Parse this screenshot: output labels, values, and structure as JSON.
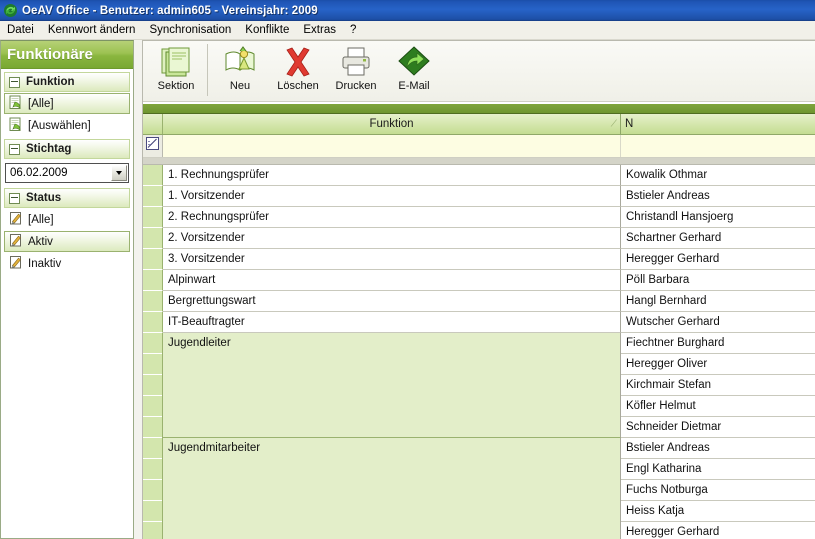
{
  "window": {
    "title": "OeAV Office - Benutzer: admin605 - Vereinsjahr: 2009",
    "app_icon": "refresh-circle-icon"
  },
  "menubar": {
    "items": [
      {
        "label": "Datei"
      },
      {
        "label": "Kennwort ändern"
      },
      {
        "label": "Synchronisation"
      },
      {
        "label": "Konflikte"
      },
      {
        "label": "Extras"
      },
      {
        "label": "?"
      }
    ]
  },
  "sidebar": {
    "title": "Funktionäre",
    "groups": [
      {
        "label": "Funktion",
        "collapse_icon": "minus-box-icon",
        "items": [
          {
            "label": "[Alle]",
            "icon": "document-green-icon",
            "selected": true
          },
          {
            "label": "[Auswählen]",
            "icon": "document-green-icon",
            "selected": false
          }
        ]
      },
      {
        "label": "Stichtag",
        "collapse_icon": "minus-box-icon",
        "date_value": "06.02.2009",
        "date_dropdown_icon": "chevron-down-icon"
      },
      {
        "label": "Status",
        "collapse_icon": "minus-box-icon",
        "items": [
          {
            "label": "[Alle]",
            "icon": "pencil-note-icon",
            "selected": false
          },
          {
            "label": "Aktiv",
            "icon": "pencil-note-icon",
            "selected": true
          },
          {
            "label": "Inaktiv",
            "icon": "pencil-note-icon",
            "selected": false
          }
        ]
      }
    ]
  },
  "toolbar": {
    "buttons": [
      {
        "label": "Sektion",
        "icon": "stacked-pages-icon"
      },
      {
        "label": "Neu",
        "icon": "new-record-book-icon"
      },
      {
        "label": "Löschen",
        "icon": "red-x-delete-icon"
      },
      {
        "label": "Drucken",
        "icon": "printer-icon"
      },
      {
        "label": "E-Mail",
        "icon": "green-diamond-arrow-icon"
      }
    ]
  },
  "grid": {
    "columns": [
      {
        "label": "Funktion",
        "sort_indicator": "ascending"
      },
      {
        "label": "N"
      }
    ],
    "filter_row": {
      "builder_icon": "filter-builder-icon"
    },
    "rows": [
      {
        "funktion": "1. Rechnungsprüfer",
        "name": "Kowalik Othmar"
      },
      {
        "funktion": "1. Vorsitzender",
        "name": "Bstieler Andreas"
      },
      {
        "funktion": "2. Rechnungsprüfer",
        "name": "Christandl Hansjoerg"
      },
      {
        "funktion": "2. Vorsitzender",
        "name": "Schartner Gerhard"
      },
      {
        "funktion": "3. Vorsitzender",
        "name": "Heregger Gerhard"
      },
      {
        "funktion": "Alpinwart",
        "name": "Pöll Barbara"
      },
      {
        "funktion": "Bergrettungswart",
        "name": "Hangl Bernhard"
      },
      {
        "funktion": "IT-Beauftragter",
        "name": "Wutscher Gerhard"
      }
    ],
    "groups": [
      {
        "funktion": "Jugendleiter",
        "names": [
          "Fiechtner Burghard",
          "Heregger Oliver",
          "Kirchmair Stefan",
          "Köfler Helmut",
          "Schneider Dietmar"
        ]
      },
      {
        "funktion": "Jugendmitarbeiter",
        "names": [
          "Bstieler Andreas",
          "Engl Katharina",
          "Fuchs Notburga",
          "Heiss Katja",
          "Heregger Gerhard"
        ]
      }
    ]
  },
  "colors": {
    "titlebar_blue": "#2763c8",
    "accent_green": "#8ab63f",
    "group_row_green": "#e3eec9",
    "gutter_green": "#d3e6ad",
    "filter_row_yellow": "#fdfde2"
  }
}
